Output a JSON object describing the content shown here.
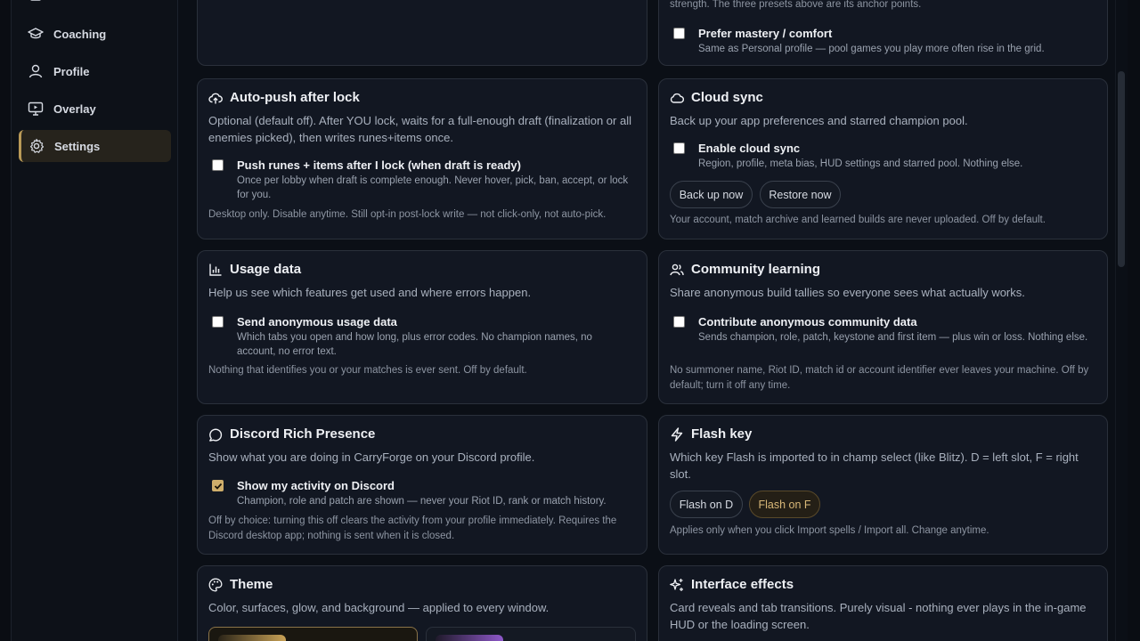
{
  "sidebar": {
    "items": [
      {
        "label": "Coaching",
        "icon": "graduation-cap-icon"
      },
      {
        "label": "Profile",
        "icon": "user-icon"
      },
      {
        "label": "Overlay",
        "icon": "monitor-play-icon"
      },
      {
        "label": "Settings",
        "icon": "gear-icon",
        "active": true
      }
    ]
  },
  "cards": {
    "top_left": {},
    "top_right": {
      "tail_text": "strength. The three presets above are its anchor points.",
      "check_label": "Prefer mastery / comfort",
      "check_sub": "Same as Personal profile — pool games you play more often rise in the grid."
    },
    "autopush": {
      "title": "Auto-push after lock",
      "desc": "Optional (default off). After YOU lock, waits for a full-enough draft (finalization or all enemies picked), then writes runes+items once.",
      "check_label": "Push runes + items after I lock (when draft is ready)",
      "check_sub": "Once per lobby when draft is complete enough. Never hover, pick, ban, accept, or lock for you.",
      "note": "Desktop only. Disable anytime. Still opt-in post-lock write — not click-only, not auto-pick."
    },
    "cloud": {
      "title": "Cloud sync",
      "desc": "Back up your app preferences and starred champion pool.",
      "check_label": "Enable cloud sync",
      "check_sub": "Region, profile, meta bias, HUD settings and starred pool. Nothing else.",
      "backup_label": "Back up now",
      "restore_label": "Restore now",
      "note": "Your account, match archive and learned builds are never uploaded. Off by default."
    },
    "usage": {
      "title": "Usage data",
      "desc": "Help us see which features get used and where errors happen.",
      "check_label": "Send anonymous usage data",
      "check_sub": "Which tabs you open and how long, plus error codes. No champion names, no account, no error text.",
      "note": "Nothing that identifies you or your matches is ever sent. Off by default."
    },
    "community": {
      "title": "Community learning",
      "desc": "Share anonymous build tallies so everyone sees what actually works.",
      "check_label": "Contribute anonymous community data",
      "check_sub": "Sends champion, role, patch, keystone and first item — plus win or loss. Nothing else.",
      "note": "No summoner name, Riot ID, match id or account identifier ever leaves your machine. Off by default; turn it off any time."
    },
    "discord": {
      "title": "Discord Rich Presence",
      "desc": "Show what you are doing in CarryForge on your Discord profile.",
      "check_label": "Show my activity on Discord",
      "check_sub": "Champion, role and patch are shown — never your Riot ID, rank or match history.",
      "checked": true,
      "note": "Off by choice: turning this off clears the activity from your profile immediately. Requires the Discord desktop app; nothing is sent when it is closed."
    },
    "flash": {
      "title": "Flash key",
      "desc": "Which key Flash is imported to in champ select (like Blitz). D = left slot, F = right slot.",
      "option_d": "Flash on D",
      "option_f": "Flash on F",
      "selected": "Flash on F",
      "note": "Applies only when you click Import spells / Import all. Change anytime."
    },
    "theme": {
      "title": "Theme",
      "desc": "Color, surfaces, glow, and background — applied to every window."
    },
    "effects": {
      "title": "Interface effects",
      "desc": "Card reveals and tab transitions. Purely visual - nothing ever plays in the in-game HUD or the loading screen."
    }
  },
  "colors": {
    "accent": "#cfae6b",
    "background": "#0b0f16",
    "card": "#121722",
    "border": "#2a303b"
  }
}
